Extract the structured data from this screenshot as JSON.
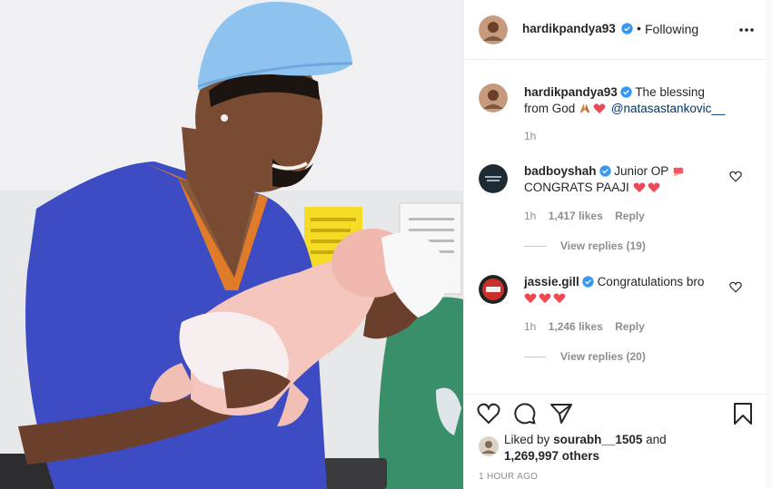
{
  "post": {
    "author": "hardikpandya93",
    "follow_dot": "•",
    "follow_label": "Following",
    "caption_text": "The blessing from God",
    "caption_mention": "@natasastankovic__",
    "caption_time": "1h"
  },
  "comments": [
    {
      "user": "badboyshah",
      "text_line1": "Junior OP",
      "text_line2": "CONGRATS PAAJI",
      "time": "1h",
      "likes": "1,417 likes",
      "reply": "Reply",
      "view_replies": "View replies (19)"
    },
    {
      "user": "jassie.gill",
      "text_line1": "Congratulations bro",
      "time": "1h",
      "likes": "1,246 likes",
      "reply": "Reply",
      "view_replies": "View replies (20)"
    }
  ],
  "actions": {
    "liked_by_prefix": "Liked by",
    "liked_by_user": "sourabh__1505",
    "liked_by_and": "and",
    "liked_by_others": "1,269,997 others",
    "timestamp": "1 HOUR AGO"
  },
  "colors": {
    "verified": "#3897f0",
    "heart_red": "#ed4956",
    "scrub_blue": "#3f4fc0",
    "collar_orange": "#e07b2a",
    "hairnet": "#8fc3ef"
  },
  "icons": [
    "more-icon",
    "verified-icon",
    "heart-icon",
    "comment-icon",
    "share-icon",
    "bookmark-icon"
  ]
}
